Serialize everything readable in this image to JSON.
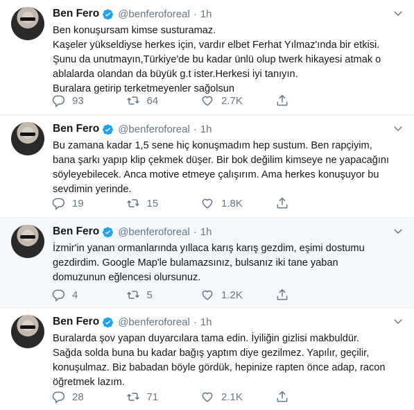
{
  "tweets": [
    {
      "name": "Ben Fero",
      "handle": "@benferoforeal",
      "separator": "·",
      "time": "1h",
      "lines": [
        "Ben konuşursam kimse susturamaz.",
        "Kaşeler yükseldiyse herkes için, vardır elbet Ferhat Yılmaz'ında bir etkisi.",
        "Şunu da unutmayın,Türkiye'de bu kadar ünlü olup twerk hikayesi atmak o",
        "ablalarda olandan da büyük g.t ister.Herkesi iyi tanıyın.",
        "Buralara getirip terketmeyenler sağolsun"
      ],
      "replies": "93",
      "retweets": "64",
      "likes": "2.7K"
    },
    {
      "name": "Ben Fero",
      "handle": "@benferoforeal",
      "separator": "·",
      "time": "1h",
      "lines": [
        "Bu zamana kadar 1,5 sene hiç konuşmadım hep sustum. Ben rapçiyim,",
        "bana şarkı yapıp klip çekmek düşer. Bir bok değilim kimseye ne yapacağını",
        "söyleyebilecek. Anca motive etmeye çalışırım. Ama herkes konuşuyor bu",
        "sevdimin yerinde."
      ],
      "replies": "19",
      "retweets": "15",
      "likes": "1.8K"
    },
    {
      "name": "Ben Fero",
      "handle": "@benferoforeal",
      "separator": "·",
      "time": "1h",
      "lines": [
        "İzmir'in yanan ormanlarında yıllaca karış karış gezdim, eşimi dostumu",
        "gezdirdim. Google Map'le bulamazsınız, bulsanız iki tane yaban",
        "domuzunun eğlencesi olursunuz."
      ],
      "replies": "4",
      "retweets": "5",
      "likes": "1.2K"
    },
    {
      "name": "Ben Fero",
      "handle": "@benferoforeal",
      "separator": "·",
      "time": "1h",
      "lines": [
        "Buralarda şov yapan duyarcılara tama edin. İyiliğin gizlisi makbuldür.",
        "Sağda solda buna bu kadar bağış yaptım diye gezilmez. Yapılır, geçilir,",
        "konuşulmaz. Biz babadan böyle gördük, hepinize rapten önce adap, racon",
        "öğretmek lazım."
      ],
      "replies": "28",
      "retweets": "71",
      "likes": "2.1K"
    }
  ],
  "colors": {
    "verified": "#1da1f2",
    "secondary_text": "#657786",
    "highlight_background": "#f5f8fa",
    "divider": "#e6ecf0"
  },
  "icons": [
    "verified-badge-icon",
    "caret-down-icon",
    "reply-icon",
    "retweet-icon",
    "like-icon",
    "share-icon"
  ]
}
